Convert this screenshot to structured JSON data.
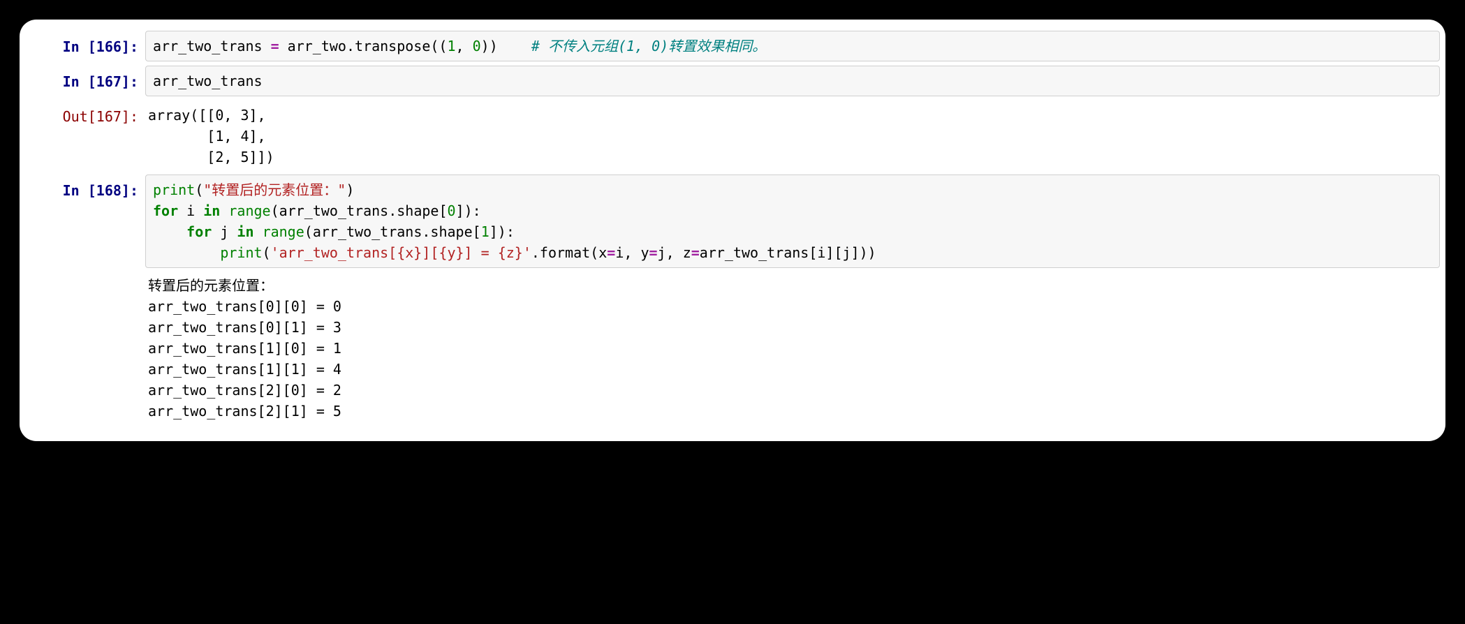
{
  "cells": [
    {
      "kind": "in",
      "exec": 166,
      "prompt": "In [166]:",
      "code": {
        "raw": "arr_two_trans = arr_two.transpose((1, 0))    # 不传入元组(1, 0)转置效果相同。",
        "tokens": [
          {
            "t": "name",
            "v": "arr_two_trans "
          },
          {
            "t": "op",
            "v": "="
          },
          {
            "t": "name",
            "v": " arr_two"
          },
          {
            "t": "punc",
            "v": "."
          },
          {
            "t": "name",
            "v": "transpose"
          },
          {
            "t": "punc",
            "v": "(("
          },
          {
            "t": "num",
            "v": "1"
          },
          {
            "t": "punc",
            "v": ", "
          },
          {
            "t": "num",
            "v": "0"
          },
          {
            "t": "punc",
            "v": "))    "
          },
          {
            "t": "cmt",
            "v": "# 不传入元组(1, 0)转置效果相同。"
          }
        ]
      }
    },
    {
      "kind": "in",
      "exec": 167,
      "prompt": "In [167]:",
      "code": {
        "raw": "arr_two_trans",
        "tokens": [
          {
            "t": "name",
            "v": "arr_two_trans"
          }
        ]
      }
    },
    {
      "kind": "out",
      "exec": 167,
      "prompt": "Out[167]:",
      "text": "array([[0, 3],\n       [1, 4],\n       [2, 5]])"
    },
    {
      "kind": "in",
      "exec": 168,
      "prompt": "In [168]:",
      "code": {
        "raw": "print(\"转置后的元素位置：\")\nfor i in range(arr_two_trans.shape[0]):\n    for j in range(arr_two_trans.shape[1]):\n        print('arr_two_trans[{x}][{y}] = {z}'.format(x=i, y=j, z=arr_two_trans[i][j]))",
        "tokens": [
          {
            "t": "bi",
            "v": "print"
          },
          {
            "t": "punc",
            "v": "("
          },
          {
            "t": "str",
            "v": "\"转置后的元素位置：\""
          },
          {
            "t": "punc",
            "v": ")\n"
          },
          {
            "t": "kw",
            "v": "for"
          },
          {
            "t": "name",
            "v": " i "
          },
          {
            "t": "kw",
            "v": "in"
          },
          {
            "t": "name",
            "v": " "
          },
          {
            "t": "bi",
            "v": "range"
          },
          {
            "t": "punc",
            "v": "("
          },
          {
            "t": "name",
            "v": "arr_two_trans"
          },
          {
            "t": "punc",
            "v": "."
          },
          {
            "t": "name",
            "v": "shape"
          },
          {
            "t": "punc",
            "v": "["
          },
          {
            "t": "num",
            "v": "0"
          },
          {
            "t": "punc",
            "v": "]):\n    "
          },
          {
            "t": "kw",
            "v": "for"
          },
          {
            "t": "name",
            "v": " j "
          },
          {
            "t": "kw",
            "v": "in"
          },
          {
            "t": "name",
            "v": " "
          },
          {
            "t": "bi",
            "v": "range"
          },
          {
            "t": "punc",
            "v": "("
          },
          {
            "t": "name",
            "v": "arr_two_trans"
          },
          {
            "t": "punc",
            "v": "."
          },
          {
            "t": "name",
            "v": "shape"
          },
          {
            "t": "punc",
            "v": "["
          },
          {
            "t": "num",
            "v": "1"
          },
          {
            "t": "punc",
            "v": "]):\n        "
          },
          {
            "t": "bi",
            "v": "print"
          },
          {
            "t": "punc",
            "v": "("
          },
          {
            "t": "str",
            "v": "'arr_two_trans[{x}][{y}] = {z}'"
          },
          {
            "t": "punc",
            "v": "."
          },
          {
            "t": "name",
            "v": "format"
          },
          {
            "t": "punc",
            "v": "("
          },
          {
            "t": "name",
            "v": "x"
          },
          {
            "t": "op",
            "v": "="
          },
          {
            "t": "name",
            "v": "i"
          },
          {
            "t": "punc",
            "v": ", "
          },
          {
            "t": "name",
            "v": "y"
          },
          {
            "t": "op",
            "v": "="
          },
          {
            "t": "name",
            "v": "j"
          },
          {
            "t": "punc",
            "v": ", "
          },
          {
            "t": "name",
            "v": "z"
          },
          {
            "t": "op",
            "v": "="
          },
          {
            "t": "name",
            "v": "arr_two_trans"
          },
          {
            "t": "punc",
            "v": "["
          },
          {
            "t": "name",
            "v": "i"
          },
          {
            "t": "punc",
            "v": "]["
          },
          {
            "t": "name",
            "v": "j"
          },
          {
            "t": "punc",
            "v": "]))"
          }
        ]
      }
    },
    {
      "kind": "stdout",
      "prompt": "",
      "text": "转置后的元素位置：\narr_two_trans[0][0] = 0\narr_two_trans[0][1] = 3\narr_two_trans[1][0] = 1\narr_two_trans[1][1] = 4\narr_two_trans[2][0] = 2\narr_two_trans[2][1] = 5"
    }
  ]
}
